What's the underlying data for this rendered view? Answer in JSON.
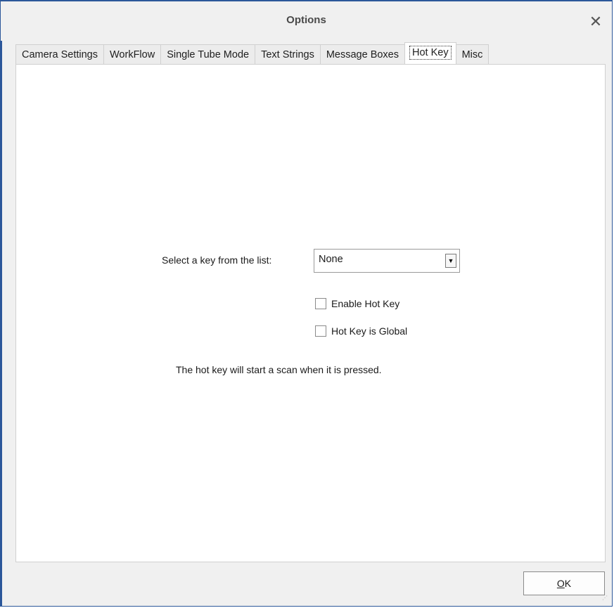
{
  "window": {
    "title": "Options",
    "close_symbol": "✕",
    "accent_color": "#2b579a"
  },
  "tabs": [
    {
      "label": "Camera Settings",
      "active": false
    },
    {
      "label": "WorkFlow",
      "active": false
    },
    {
      "label": "Single Tube Mode",
      "active": false
    },
    {
      "label": "Text Strings",
      "active": false
    },
    {
      "label": "Message Boxes",
      "active": false
    },
    {
      "label": "Hot Key",
      "active": true
    },
    {
      "label": "Misc",
      "active": false
    }
  ],
  "hotkey": {
    "select_label": "Select a key from the list:",
    "select_value": "None",
    "dropdown_arrow": "▼",
    "enable_label": "Enable Hot Key",
    "enable_checked": false,
    "global_label": "Hot Key is Global",
    "global_checked": false,
    "info_text": "The hot key will start a scan when it is pressed."
  },
  "footer": {
    "ok_label": "OK",
    "ok_mnemonic": "O"
  }
}
